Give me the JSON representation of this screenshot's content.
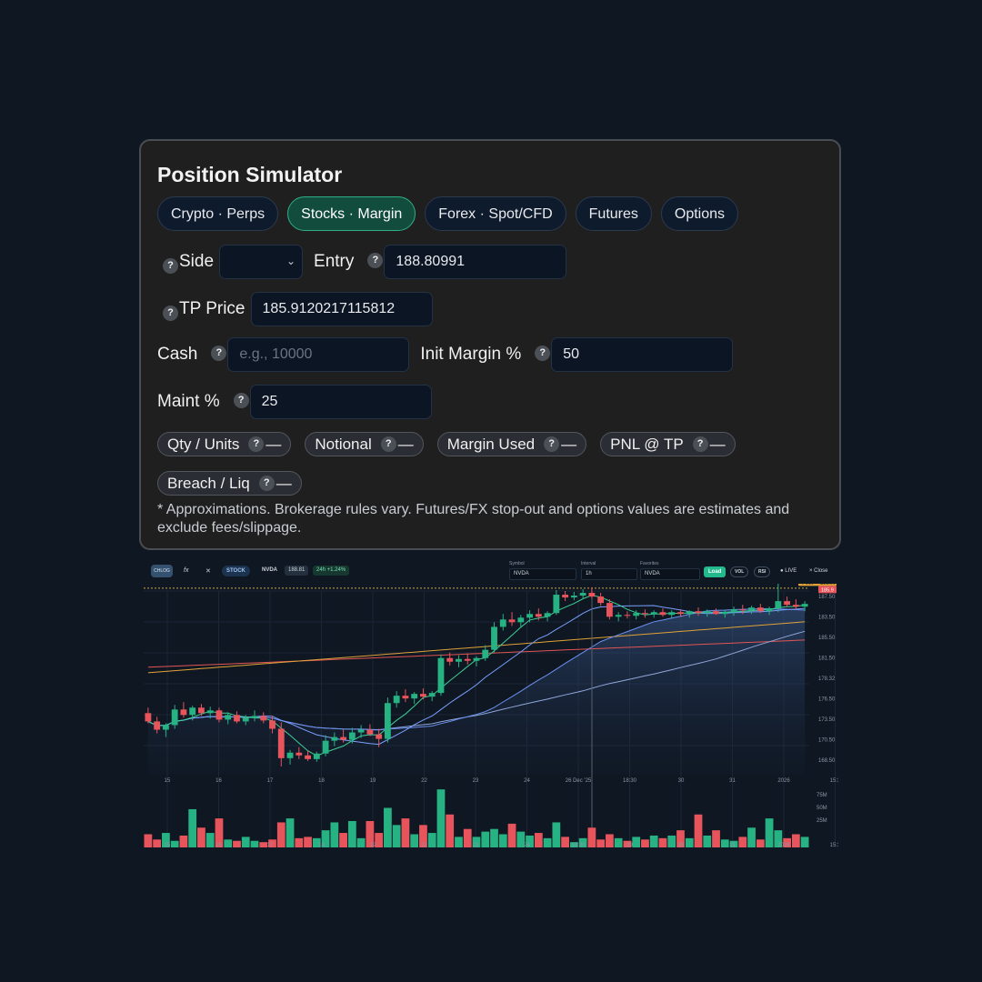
{
  "simulator": {
    "title": "Position Simulator",
    "tabs": [
      {
        "label": "Crypto · Perps",
        "active": false
      },
      {
        "label": "Stocks · Margin",
        "active": true
      },
      {
        "label": "Forex · Spot/CFD",
        "active": false
      },
      {
        "label": "Futures",
        "active": false
      },
      {
        "label": "Options",
        "active": false
      }
    ],
    "help_glyph": "?",
    "side": {
      "label": "Side",
      "value": ""
    },
    "entry": {
      "label": "Entry",
      "value": "188.80991"
    },
    "tp": {
      "label": "TP Price",
      "value": "185.9120217115812"
    },
    "cash": {
      "label": "Cash",
      "value": "",
      "placeholder": "e.g., 10000"
    },
    "init_margin": {
      "label": "Init Margin %",
      "value": "50"
    },
    "maint": {
      "label": "Maint %",
      "value": "25"
    },
    "outputs": [
      {
        "label": "Qty / Units",
        "value": "—"
      },
      {
        "label": "Notional",
        "value": "—"
      },
      {
        "label": "Margin Used",
        "value": "—"
      },
      {
        "label": "PNL @ TP",
        "value": "—"
      },
      {
        "label": "Breach / Liq",
        "value": "—"
      }
    ],
    "note": "* Approximations. Brokerage rules vary. Futures/FX stop-out and options values are estimates and exclude fees/slippage."
  },
  "chart_toolbar": {
    "logo": "CHLOG",
    "fx": "fx",
    "asset_class": "STOCK",
    "symbol": "NVDA",
    "price": "188.81",
    "change": "24h +1.24%",
    "symbol_label": "Symbol",
    "symbol_value": "NVDA",
    "interval_label": "Interval",
    "interval_value": "1h",
    "favorites_label": "Favorites",
    "favorites_value": "NVDA",
    "load": "Load",
    "vol": "VOL",
    "rsi": "RSI",
    "live": "LIVE",
    "close": "× Close"
  },
  "chart_data": {
    "type": "candlestick",
    "symbol": "NVDA",
    "interval": "1h",
    "x_ticks": [
      "15",
      "16",
      "17",
      "18",
      "19",
      "22",
      "23",
      "24",
      "26 Dec '25",
      "18:30",
      "30",
      "31",
      "2026",
      "15:3"
    ],
    "volume_x_ticks": [
      "15",
      "16",
      "17",
      "18",
      "19",
      "22",
      "23",
      "24",
      "10:30",
      "29",
      "30",
      "31",
      "2026",
      "15:3"
    ],
    "y_ticks": [
      187.5,
      183.5,
      185.5,
      181.5,
      178.32,
      176.5,
      173.5,
      170.5,
      168.5
    ],
    "y_tick_labels": [
      "187.50",
      "183.50",
      "185.50",
      "181.50",
      "178.32",
      "176.50",
      "173.50",
      "170.50",
      "168.50"
    ],
    "ylim": [
      168.5,
      188.5
    ],
    "last_price": 188.96,
    "last_badge": "188.96",
    "post_badge": "Post",
    "tp_badge": "185.9",
    "entry_line": 188.81,
    "volume_ticks": [
      "75M",
      "50M",
      "25M"
    ],
    "candles": [
      [
        175.2,
        175.8,
        174.1,
        174.3
      ],
      [
        174.3,
        174.8,
        173.0,
        173.4
      ],
      [
        173.4,
        174.1,
        172.6,
        173.9
      ],
      [
        173.9,
        176.1,
        173.5,
        175.6
      ],
      [
        175.6,
        176.4,
        174.7,
        175.0
      ],
      [
        175.0,
        176.0,
        174.4,
        175.8
      ],
      [
        175.8,
        176.2,
        174.9,
        175.2
      ],
      [
        175.2,
        175.9,
        174.6,
        175.5
      ],
      [
        175.5,
        175.8,
        174.2,
        174.5
      ],
      [
        174.5,
        175.3,
        174.0,
        175.0
      ],
      [
        175.0,
        175.4,
        174.1,
        174.3
      ],
      [
        174.3,
        175.0,
        173.9,
        174.7
      ],
      [
        174.7,
        175.5,
        174.3,
        174.9
      ],
      [
        174.9,
        175.3,
        174.1,
        174.4
      ],
      [
        174.4,
        174.9,
        173.0,
        173.5
      ],
      [
        173.5,
        174.2,
        169.4,
        170.3
      ],
      [
        170.3,
        171.2,
        169.6,
        170.9
      ],
      [
        170.9,
        171.5,
        170.2,
        170.6
      ],
      [
        170.6,
        171.1,
        170.0,
        170.2
      ],
      [
        170.2,
        171.0,
        169.9,
        170.8
      ],
      [
        170.8,
        172.8,
        170.5,
        172.2
      ],
      [
        172.2,
        173.1,
        171.6,
        172.6
      ],
      [
        172.6,
        173.4,
        172.0,
        172.3
      ],
      [
        172.3,
        173.6,
        171.9,
        173.1
      ],
      [
        173.1,
        173.9,
        172.5,
        173.4
      ],
      [
        173.4,
        174.0,
        172.7,
        172.9
      ],
      [
        172.9,
        173.5,
        171.5,
        172.4
      ],
      [
        172.4,
        176.9,
        172.0,
        176.3
      ],
      [
        176.3,
        177.6,
        175.8,
        177.1
      ],
      [
        177.1,
        177.8,
        176.4,
        176.8
      ],
      [
        176.8,
        177.5,
        176.2,
        177.3
      ],
      [
        177.3,
        177.9,
        176.7,
        177.0
      ],
      [
        177.0,
        177.6,
        176.5,
        177.4
      ],
      [
        177.4,
        181.6,
        177.1,
        181.2
      ],
      [
        181.2,
        181.8,
        180.4,
        180.8
      ],
      [
        180.8,
        181.5,
        180.2,
        181.1
      ],
      [
        181.1,
        181.7,
        180.5,
        180.9
      ],
      [
        180.9,
        181.4,
        180.3,
        181.2
      ],
      [
        181.2,
        182.6,
        180.9,
        182.1
      ],
      [
        182.1,
        185.1,
        181.8,
        184.6
      ],
      [
        184.6,
        186.0,
        184.2,
        185.4
      ],
      [
        185.4,
        186.2,
        184.7,
        185.1
      ],
      [
        185.1,
        185.9,
        184.5,
        185.6
      ],
      [
        185.6,
        186.4,
        185.1,
        186.0
      ],
      [
        186.0,
        186.6,
        185.3,
        185.7
      ],
      [
        185.7,
        186.3,
        185.2,
        186.1
      ],
      [
        186.1,
        188.6,
        185.9,
        188.1
      ],
      [
        188.1,
        188.5,
        187.4,
        187.8
      ],
      [
        187.8,
        188.4,
        187.5,
        188.0
      ],
      [
        188.0,
        188.7,
        187.6,
        188.3
      ],
      [
        188.3,
        188.9,
        187.7,
        187.9
      ],
      [
        187.9,
        188.3,
        186.9,
        187.2
      ],
      [
        187.2,
        187.6,
        185.4,
        185.7
      ],
      [
        185.7,
        186.2,
        185.2,
        185.9
      ],
      [
        185.9,
        186.3,
        185.5,
        185.8
      ],
      [
        185.8,
        186.4,
        185.4,
        186.1
      ],
      [
        186.1,
        186.5,
        185.6,
        186.0
      ],
      [
        186.0,
        186.4,
        185.6,
        186.2
      ],
      [
        186.2,
        186.6,
        185.7,
        185.9
      ],
      [
        185.9,
        186.4,
        185.5,
        186.2
      ],
      [
        186.2,
        186.5,
        185.7,
        186.0
      ],
      [
        186.0,
        186.4,
        185.6,
        186.3
      ],
      [
        186.3,
        186.7,
        185.8,
        186.1
      ],
      [
        186.1,
        186.5,
        185.7,
        186.3
      ],
      [
        186.3,
        186.6,
        185.9,
        186.0
      ],
      [
        186.0,
        186.4,
        185.6,
        186.2
      ],
      [
        186.2,
        186.8,
        185.8,
        186.5
      ],
      [
        186.5,
        187.0,
        186.0,
        186.4
      ],
      [
        186.4,
        186.9,
        186.0,
        186.7
      ],
      [
        186.7,
        187.1,
        186.1,
        186.3
      ],
      [
        186.3,
        186.8,
        185.9,
        186.6
      ],
      [
        186.6,
        189.4,
        186.2,
        187.4
      ],
      [
        187.4,
        187.9,
        186.8,
        187.0
      ],
      [
        187.0,
        187.6,
        186.5,
        186.8
      ],
      [
        186.8,
        187.4,
        186.3,
        187.1
      ]
    ],
    "volume_values_m": [
      20,
      12,
      22,
      10,
      18,
      58,
      30,
      22,
      44,
      12,
      10,
      16,
      10,
      8,
      12,
      38,
      44,
      14,
      16,
      14,
      26,
      38,
      22,
      40,
      14,
      40,
      22,
      60,
      34,
      44,
      20,
      34,
      22,
      88,
      50,
      16,
      28,
      16,
      24,
      28,
      20,
      36,
      24,
      18,
      22,
      14,
      38,
      16,
      8,
      14,
      30,
      12,
      20,
      14,
      10,
      16,
      12,
      18,
      14,
      18,
      26,
      14,
      50,
      18,
      26,
      12,
      10,
      16,
      30,
      12,
      44,
      26,
      14,
      20,
      16
    ]
  }
}
